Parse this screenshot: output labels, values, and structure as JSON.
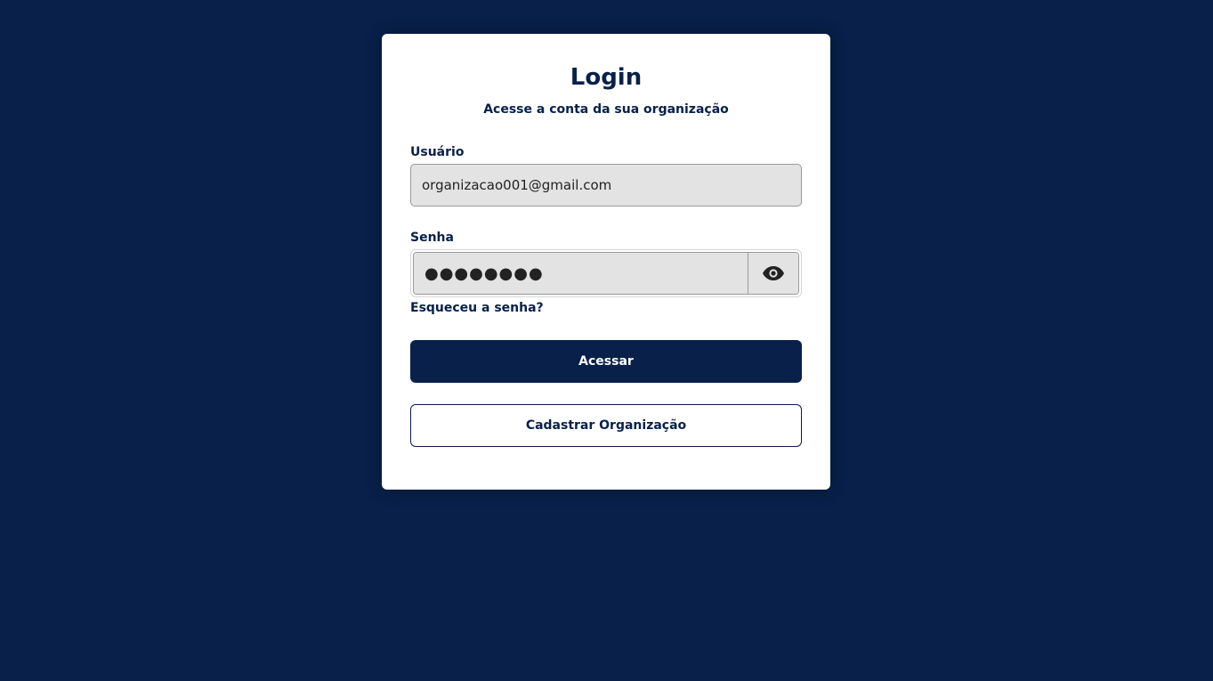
{
  "login": {
    "title": "Login",
    "subtitle": "Acesse a conta da sua organização",
    "user_label": "Usuário",
    "user_value": "organizacao001@gmail.com",
    "password_label": "Senha",
    "password_masked": "●●●●●●●●",
    "toggle_icon": "eye-icon",
    "forgot_link": "Esqueceu a senha?",
    "submit_label": "Acessar",
    "register_label": "Cadastrar Organização"
  },
  "colors": {
    "background": "#08204a",
    "card": "#ffffff",
    "input_bg": "#e3e3e3",
    "accent": "#08204a"
  }
}
